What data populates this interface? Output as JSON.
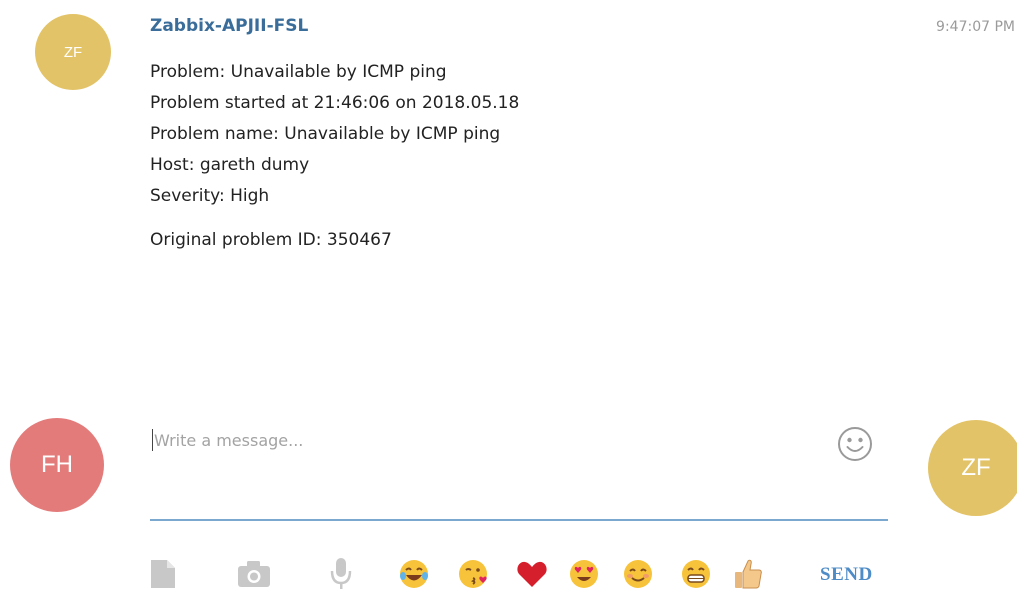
{
  "chat": {
    "sender_initials": "ZF",
    "sender_name": "Zabbix-APJII-FSL",
    "timestamp": "9:47:07 PM",
    "message_lines": [
      "Problem: Unavailable by ICMP ping",
      "Problem started at 21:46:06 on 2018.05.18",
      "Problem name: Unavailable by ICMP ping",
      "Host: gareth dumy",
      "Severity: High",
      "",
      "Original problem ID: 350467"
    ]
  },
  "composer": {
    "self_initials": "FH",
    "peer_initials": "ZF",
    "placeholder": "Write a message...",
    "value": "",
    "emoji_button_icon": "smiley-icon",
    "send_label": "SEND"
  },
  "toolbar": {
    "items": [
      "document-icon",
      "camera-icon",
      "microphone-icon",
      "laughing-crying-emoji",
      "kissing-heart-emoji",
      "red-heart-emoji",
      "heart-eyes-emoji",
      "smiling-blush-emoji",
      "grinning-teeth-emoji",
      "thumbs-up-emoji"
    ]
  },
  "colors": {
    "sender_avatar": "#e3c367",
    "self_avatar": "#e37b7b",
    "peer_avatar": "#e3c367",
    "sender_name": "#3a6d99",
    "accent": "#4d8cc7",
    "underline": "#7ba8cf"
  }
}
